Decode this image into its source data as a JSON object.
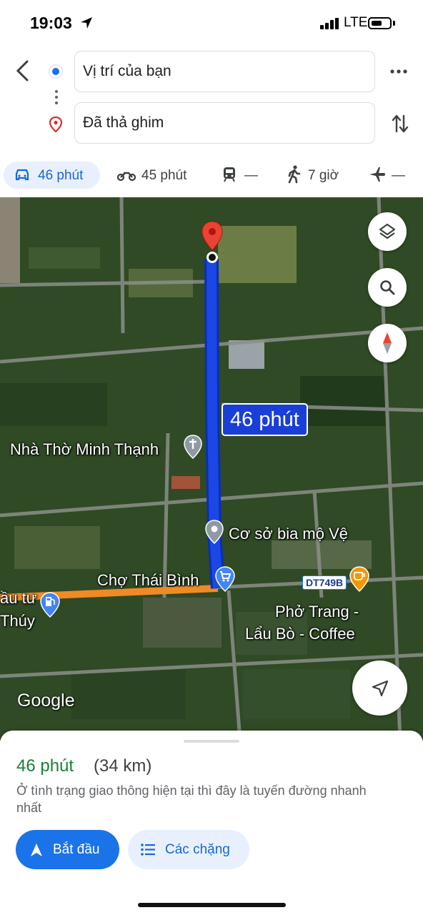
{
  "status_bar": {
    "time": "19:03",
    "network": "LTE"
  },
  "route": {
    "origin": "Vị trí của bạn",
    "destination": "Đã thả ghim"
  },
  "modes": [
    {
      "icon": "car-icon",
      "label": "46 phút",
      "selected": true
    },
    {
      "icon": "motorbike-icon",
      "label": "45 phút"
    },
    {
      "icon": "transit-icon",
      "label": "—"
    },
    {
      "icon": "walk-icon",
      "label": "7 giờ"
    },
    {
      "icon": "flight-icon",
      "label": "—"
    }
  ],
  "map": {
    "route_badge": "46 phút",
    "labels": {
      "church": "Nhà Thờ Minh Thạnh",
      "graves": "Cơ sở bia mộ Vệ",
      "market": "Chợ Thái Bình",
      "pho_line1": "Phở Trang -",
      "pho_line2": "Lẩu Bò - Coffee",
      "gas_line1": "ầu tư",
      "gas_line2": "Thúy",
      "road_shield": "DT749B"
    },
    "logo": "Google",
    "colors": {
      "route": "#1a47e6",
      "alt_route": "#f08a24",
      "pin": "#ea4335"
    }
  },
  "sheet": {
    "eta": "46 phút",
    "distance": "(34 km)",
    "description": "Ở tình trạng giao thông hiện tại thì đây là tuyến đường nhanh nhất",
    "start_label": "Bắt đầu",
    "steps_label": "Các chặng"
  }
}
